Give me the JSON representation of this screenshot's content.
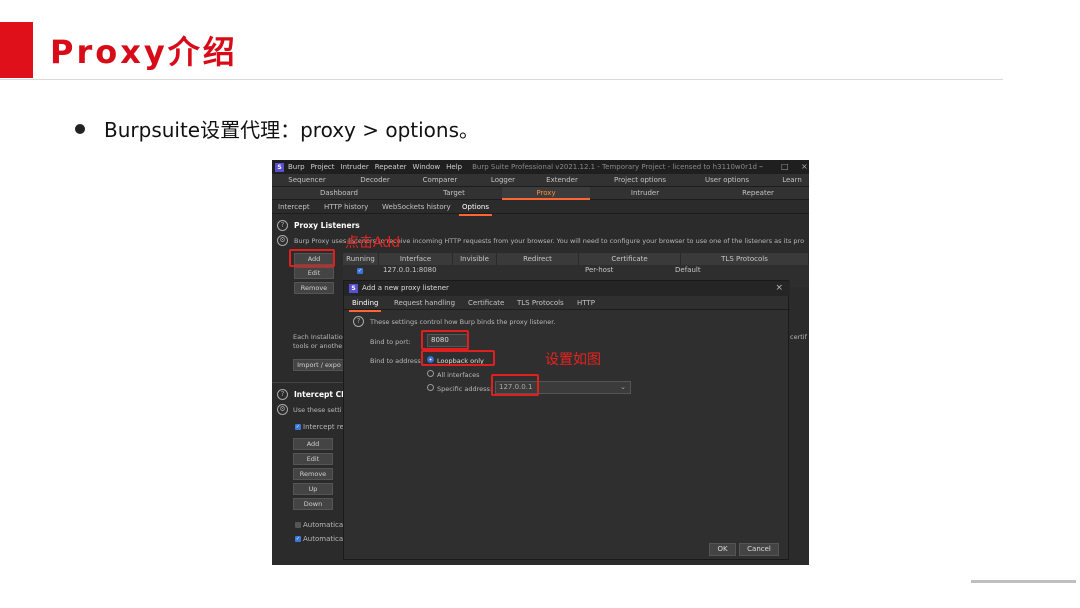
{
  "slide": {
    "title": "Proxy介绍",
    "bullet": "Burpsuite设置代理：proxy > options。"
  },
  "burp": {
    "menu": [
      "Burp",
      "Project",
      "Intruder",
      "Repeater",
      "Window",
      "Help"
    ],
    "window_title": "Burp Suite Professional v2021.12.1 - Temporary Project - licensed to h3110w0r1d",
    "tabs_row1": [
      "Sequencer",
      "Decoder",
      "Comparer",
      "Logger",
      "Extender",
      "Project options",
      "User options",
      "Learn"
    ],
    "tabs_row2": [
      "Dashboard",
      "Target",
      "Proxy",
      "Intruder",
      "Repeater"
    ],
    "active_tab": "Proxy",
    "subtabs": [
      "Intercept",
      "HTTP history",
      "WebSockets history",
      "Options"
    ],
    "active_subtab": "Options",
    "listeners": {
      "title": "Proxy Listeners",
      "description": "Burp Proxy uses listeners to receive incoming HTTP requests from your browser. You will need to configure your browser to use one of the listeners as its pro",
      "buttons": [
        "Add",
        "Edit",
        "Remove"
      ],
      "columns": [
        "Running",
        "Interface",
        "Invisible",
        "Redirect",
        "Certificate",
        "TLS Protocols"
      ],
      "row": {
        "running": "✓",
        "interface": "127.0.0.1:8080",
        "invisible": "",
        "redirect": "",
        "certificate": "Per-host",
        "tls": "Default"
      },
      "ca_text": [
        "Each Installatio",
        "tools or anothe"
      ],
      "ca_suffix": "certif",
      "import_button": "Import / expo"
    },
    "intercept": {
      "title": "Intercept Cli",
      "description": "Use these setti",
      "checkbox_label": "Intercept req",
      "buttons": [
        "Add",
        "Edit",
        "Remove",
        "Up",
        "Down"
      ],
      "auto1": "Automatical",
      "auto2": "Automatical"
    },
    "dialog": {
      "title": "Add a new proxy listener",
      "close": "×",
      "tabs": [
        "Binding",
        "Request handling",
        "Certificate",
        "TLS Protocols",
        "HTTP"
      ],
      "active_tab": "Binding",
      "help": "These settings control how Burp binds the proxy listener.",
      "port_label": "Bind to port:",
      "port_value": "8080",
      "address_label": "Bind to address:",
      "options": [
        "Loopback only",
        "All interfaces",
        "Specific address:"
      ],
      "selected_option": "Loopback only",
      "specific_value": "127.0.0.1",
      "ok": "OK",
      "cancel": "Cancel"
    }
  },
  "annotations": {
    "click_add": "点击Add",
    "set_as_shown": "设置如图"
  },
  "colors": {
    "brand_red": "#d80c18",
    "burp_orange": "#ff6633",
    "annotation_red": "#e02020"
  }
}
